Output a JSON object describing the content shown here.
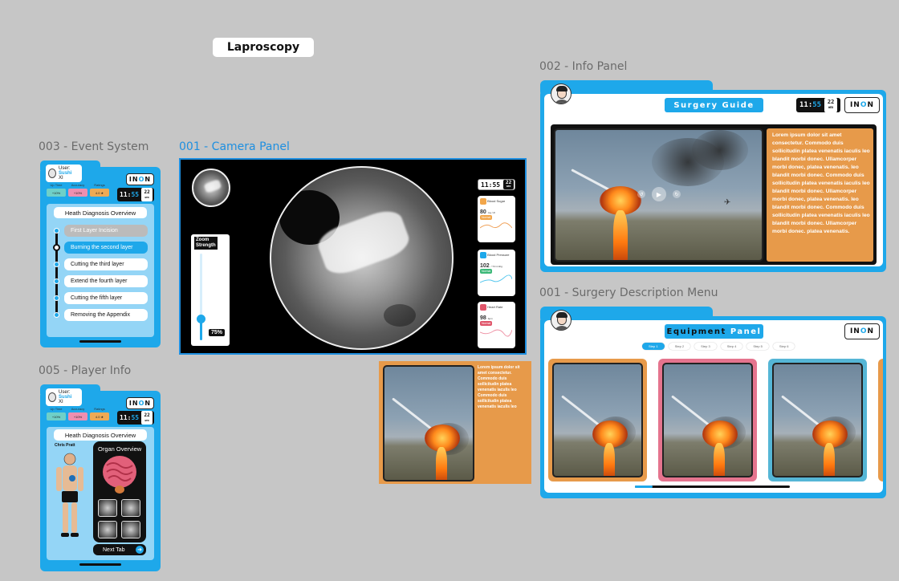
{
  "canvas_title": "Laproscopy",
  "frames": {
    "event_system": "003 - Event System",
    "camera_panel": "001 - Camera Panel",
    "player_info": "005 - Player Info",
    "info_panel": "002 - Info Panel",
    "surgery_menu": "001 - Surgery Description Menu"
  },
  "hud": {
    "user_label": "User:",
    "user_name": "Sushi",
    "user_id": "XI",
    "time_h": "11",
    "time_m": "55",
    "date_day": "22",
    "date_wk": "WED",
    "stats": [
      {
        "label": "Up Time",
        "value": "+10%",
        "color": "#6fd0c8"
      },
      {
        "label": "Accuracy",
        "value": "+10%",
        "color": "#ef8fb0"
      },
      {
        "label": "Ratings",
        "value": "4.0 ★",
        "color": "#eeaa55"
      }
    ],
    "logo_pre": "IN",
    "logo_o": "O",
    "logo_post": "N",
    "logo_sub": "VR"
  },
  "event_system": {
    "title": "Heath Diagnosis Overview",
    "steps": [
      {
        "label": "First Layer Incision",
        "state": "done"
      },
      {
        "label": "Burning the second layer",
        "state": "active"
      },
      {
        "label": "Cutting the third layer",
        "state": "todo"
      },
      {
        "label": "Extend the fourth layer",
        "state": "todo"
      },
      {
        "label": "Cutting the fifth layer",
        "state": "todo"
      },
      {
        "label": "Removing the Appendix",
        "state": "todo"
      }
    ]
  },
  "camera": {
    "time": "11:55",
    "date_day": "22",
    "date_wk": "WED",
    "zoom_title_1": "Zoom",
    "zoom_title_2": "Strength",
    "zoom_value": "75%",
    "zoom_level": 0.75,
    "vitals": [
      {
        "name": "Blood Sugar",
        "value": "80",
        "unit": "mg / dl",
        "tag": "Normal",
        "icon": "drop-sugar-icon",
        "color": "#f2a64a",
        "line": "#f0a25a"
      },
      {
        "name": "Blood Pressure",
        "value": "102",
        "unit": "/ 72 mmhg",
        "tag": "Normal",
        "icon": "blood-drop-icon",
        "color": "#1ea8ea",
        "line": "#59c8ee"
      },
      {
        "name": "Heart Rate",
        "value": "98",
        "unit": "bpm",
        "tag": "Normal",
        "icon": "heart-icon",
        "color": "#e0556a",
        "line": "#ef96a8"
      }
    ]
  },
  "info_panel": {
    "banner_1": "Surgery",
    "banner_2": "Guide",
    "lorem": "Lorem ipsum dolor sit amet consectetur. Commodo duis sollicitudin platea venenatis iaculis leo blandit morbi donec. Ullamcorper morbi donec, platea venenatis. leo blandit morbi donec. Commodo duis sollicitudin platea venenatis iaculis leo blandit morbi donec. Ullamcorper morbi donec, platea venenatis. leo blandit morbi donec. Commodo duis sollicitudin platea venenatis iaculis leo blandit morbi donec. Ullamcorper morbi donec. platea venenatis."
  },
  "floating_card": {
    "lorem": "Lorem ipsum dolor sit amet consectetur. Commodo duis sollicitudin platea venenatis iaculis leo Commodo duis sollicitudin platea venenatis iaculis leo"
  },
  "equipment": {
    "banner_1": "Equipment",
    "banner_2": "Panel",
    "steps": [
      "Step 1",
      "Step 2",
      "Step 3",
      "Step 4",
      "Step 5",
      "Step 6"
    ],
    "card_colors": [
      "#e79a4a",
      "#e5748e",
      "#55b6d6"
    ]
  },
  "player_info": {
    "title": "Heath Diagnosis Overview",
    "player_name": "Chris Pratt",
    "organ_title": "Organ Overview",
    "next_label": "Next Tab"
  }
}
